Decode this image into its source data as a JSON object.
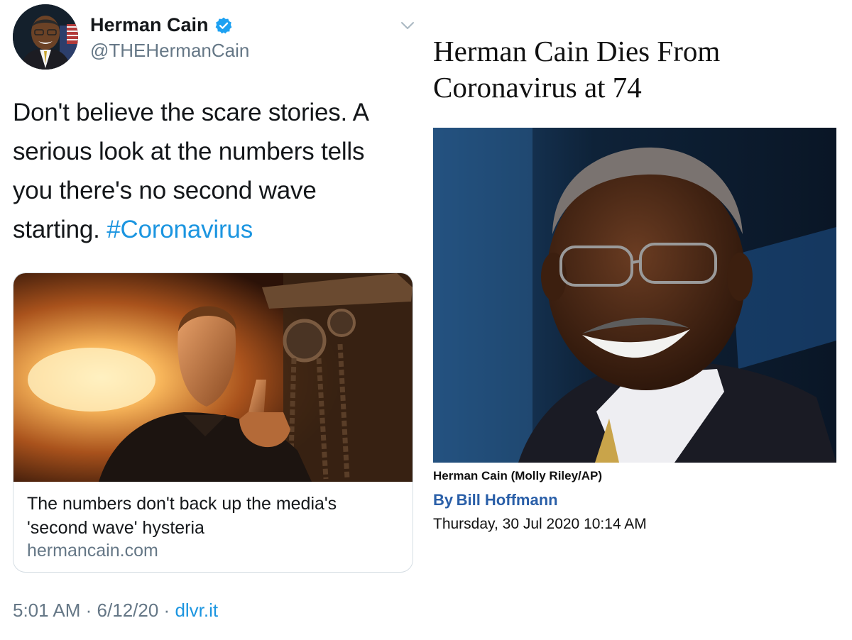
{
  "tweet": {
    "author": {
      "name": "Herman Cain",
      "handle": "@THEHermanCain",
      "verified": true,
      "avatar_icon": "profile-photo"
    },
    "text": {
      "line1": "Don't believe the scare stories. A",
      "line2": "serious look at the numbers tells",
      "line3": "you there's no second wave",
      "line4": "starting.",
      "hashtag": "#Coronavirus"
    },
    "card": {
      "title_line1": "The numbers don't back up the media's",
      "title_line2": "'second wave' hysteria",
      "domain": "hermancain.com"
    },
    "meta": {
      "time": "5:01 AM",
      "separator": "·",
      "date": "6/12/20",
      "source": "dlvr.it"
    },
    "colors": {
      "link": "#1b95e0",
      "secondary": "#657786",
      "verified": "#1da1f2"
    }
  },
  "article": {
    "headline_line1": "Herman Cain Dies From",
    "headline_line2": "Coronavirus at 74",
    "photo_caption": "Herman Cain (Molly Riley/AP)",
    "byline_prefix": "By",
    "byline_author": "Bill Hoffmann",
    "dateline": "Thursday, 30 Jul 2020 10:14 AM",
    "colors": {
      "byline": "#2a5fa8"
    }
  }
}
